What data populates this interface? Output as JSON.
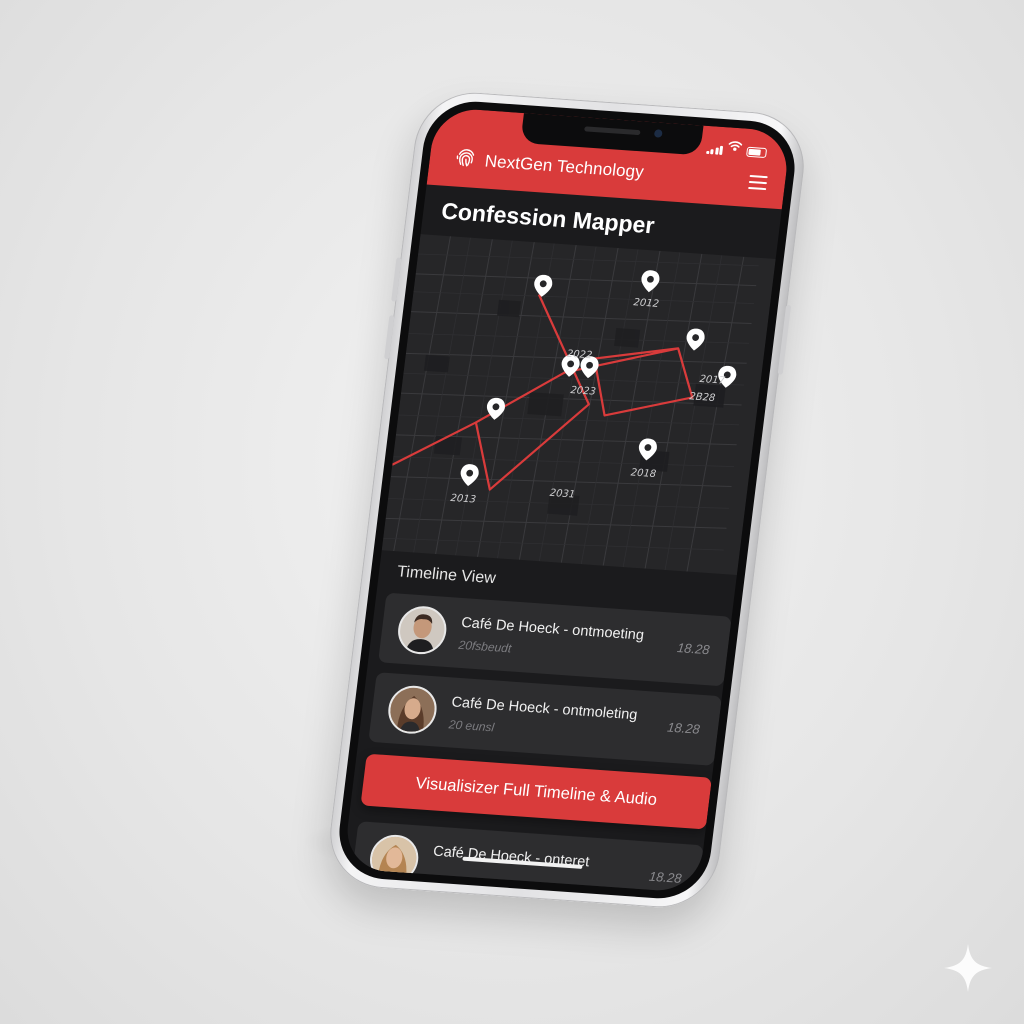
{
  "status_bar": {
    "icons": [
      "signal-icon",
      "wifi-icon",
      "battery-icon"
    ]
  },
  "header": {
    "brand_name": "NextGen Technology",
    "brand_icon": "fingerprint-icon",
    "menu_icon": "hamburger-menu-icon",
    "background_color": "#d93b3b"
  },
  "app": {
    "title": "Confession Mapper"
  },
  "map": {
    "pin_icon": "map-pin-icon",
    "route_color": "#d93b3b",
    "labels": [
      "2012",
      "2022",
      "2017",
      "2023",
      "2B28",
      "2018",
      "2013",
      "2031"
    ]
  },
  "timeline": {
    "title": "Timeline View",
    "items": [
      {
        "title": "Café De Hoeck - ontmoeting",
        "subtitle": "20fsbeudt",
        "time": "18.28"
      },
      {
        "title": "Café De Hoeck - ontmoleting",
        "subtitle": "20 eunsl",
        "time": "18.28"
      },
      {
        "title": "Café De Hoeck - onteret",
        "subtitle": "",
        "time": "18.28"
      }
    ]
  },
  "cta": {
    "label": "Visualisizer Full Timeline & Audio"
  },
  "accent_color": "#d93b3b"
}
